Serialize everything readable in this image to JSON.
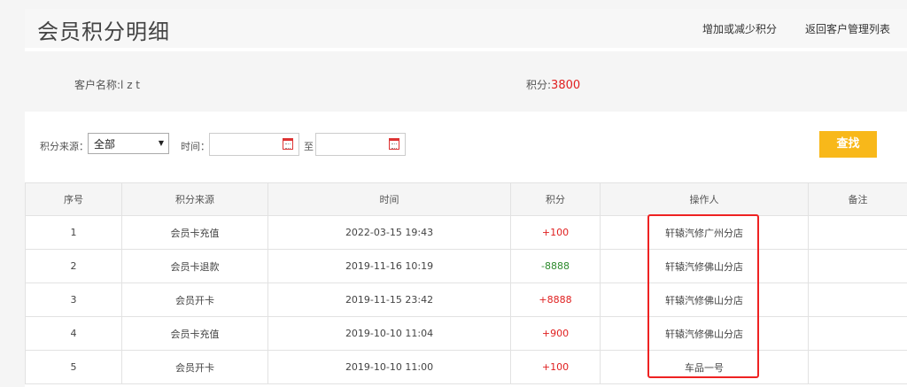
{
  "header": {
    "title": "会员积分明细",
    "link_adjust": "增加或减少积分",
    "link_back": "返回客户管理列表"
  },
  "info": {
    "customer_label": "客户名称:l z t",
    "points_label": "积分:",
    "points_value": "3800"
  },
  "filter": {
    "source_label": "积分来源：",
    "source_selected": "全部",
    "time_label": "时间：",
    "to_label": "至",
    "search_label": "查找"
  },
  "table": {
    "headers": [
      "序号",
      "积分来源",
      "时间",
      "积分",
      "操作人",
      "备注"
    ],
    "rows": [
      {
        "no": "1",
        "source": "会员卡充值",
        "time": "2022-03-15 19:43",
        "points": "+100",
        "operator": "轩辕汽修广州分店",
        "note": ""
      },
      {
        "no": "2",
        "source": "会员卡退款",
        "time": "2019-11-16 10:19",
        "points": "-8888",
        "operator": "轩辕汽修佛山分店",
        "note": ""
      },
      {
        "no": "3",
        "source": "会员开卡",
        "time": "2019-11-15 23:42",
        "points": "+8888",
        "operator": "轩辕汽修佛山分店",
        "note": ""
      },
      {
        "no": "4",
        "source": "会员卡充值",
        "time": "2019-10-10 11:04",
        "points": "+900",
        "operator": "轩辕汽修佛山分店",
        "note": ""
      },
      {
        "no": "5",
        "source": "会员开卡",
        "time": "2019-10-10 11:00",
        "points": "+100",
        "operator": "车品一号",
        "note": ""
      }
    ]
  },
  "colors": {
    "accent": "#f8b81a",
    "positive": "#e02020",
    "negative": "#2d8a2d",
    "highlight_box": "#ee2222"
  },
  "icons": [
    "calendar-icon",
    "chevron-down-icon"
  ]
}
